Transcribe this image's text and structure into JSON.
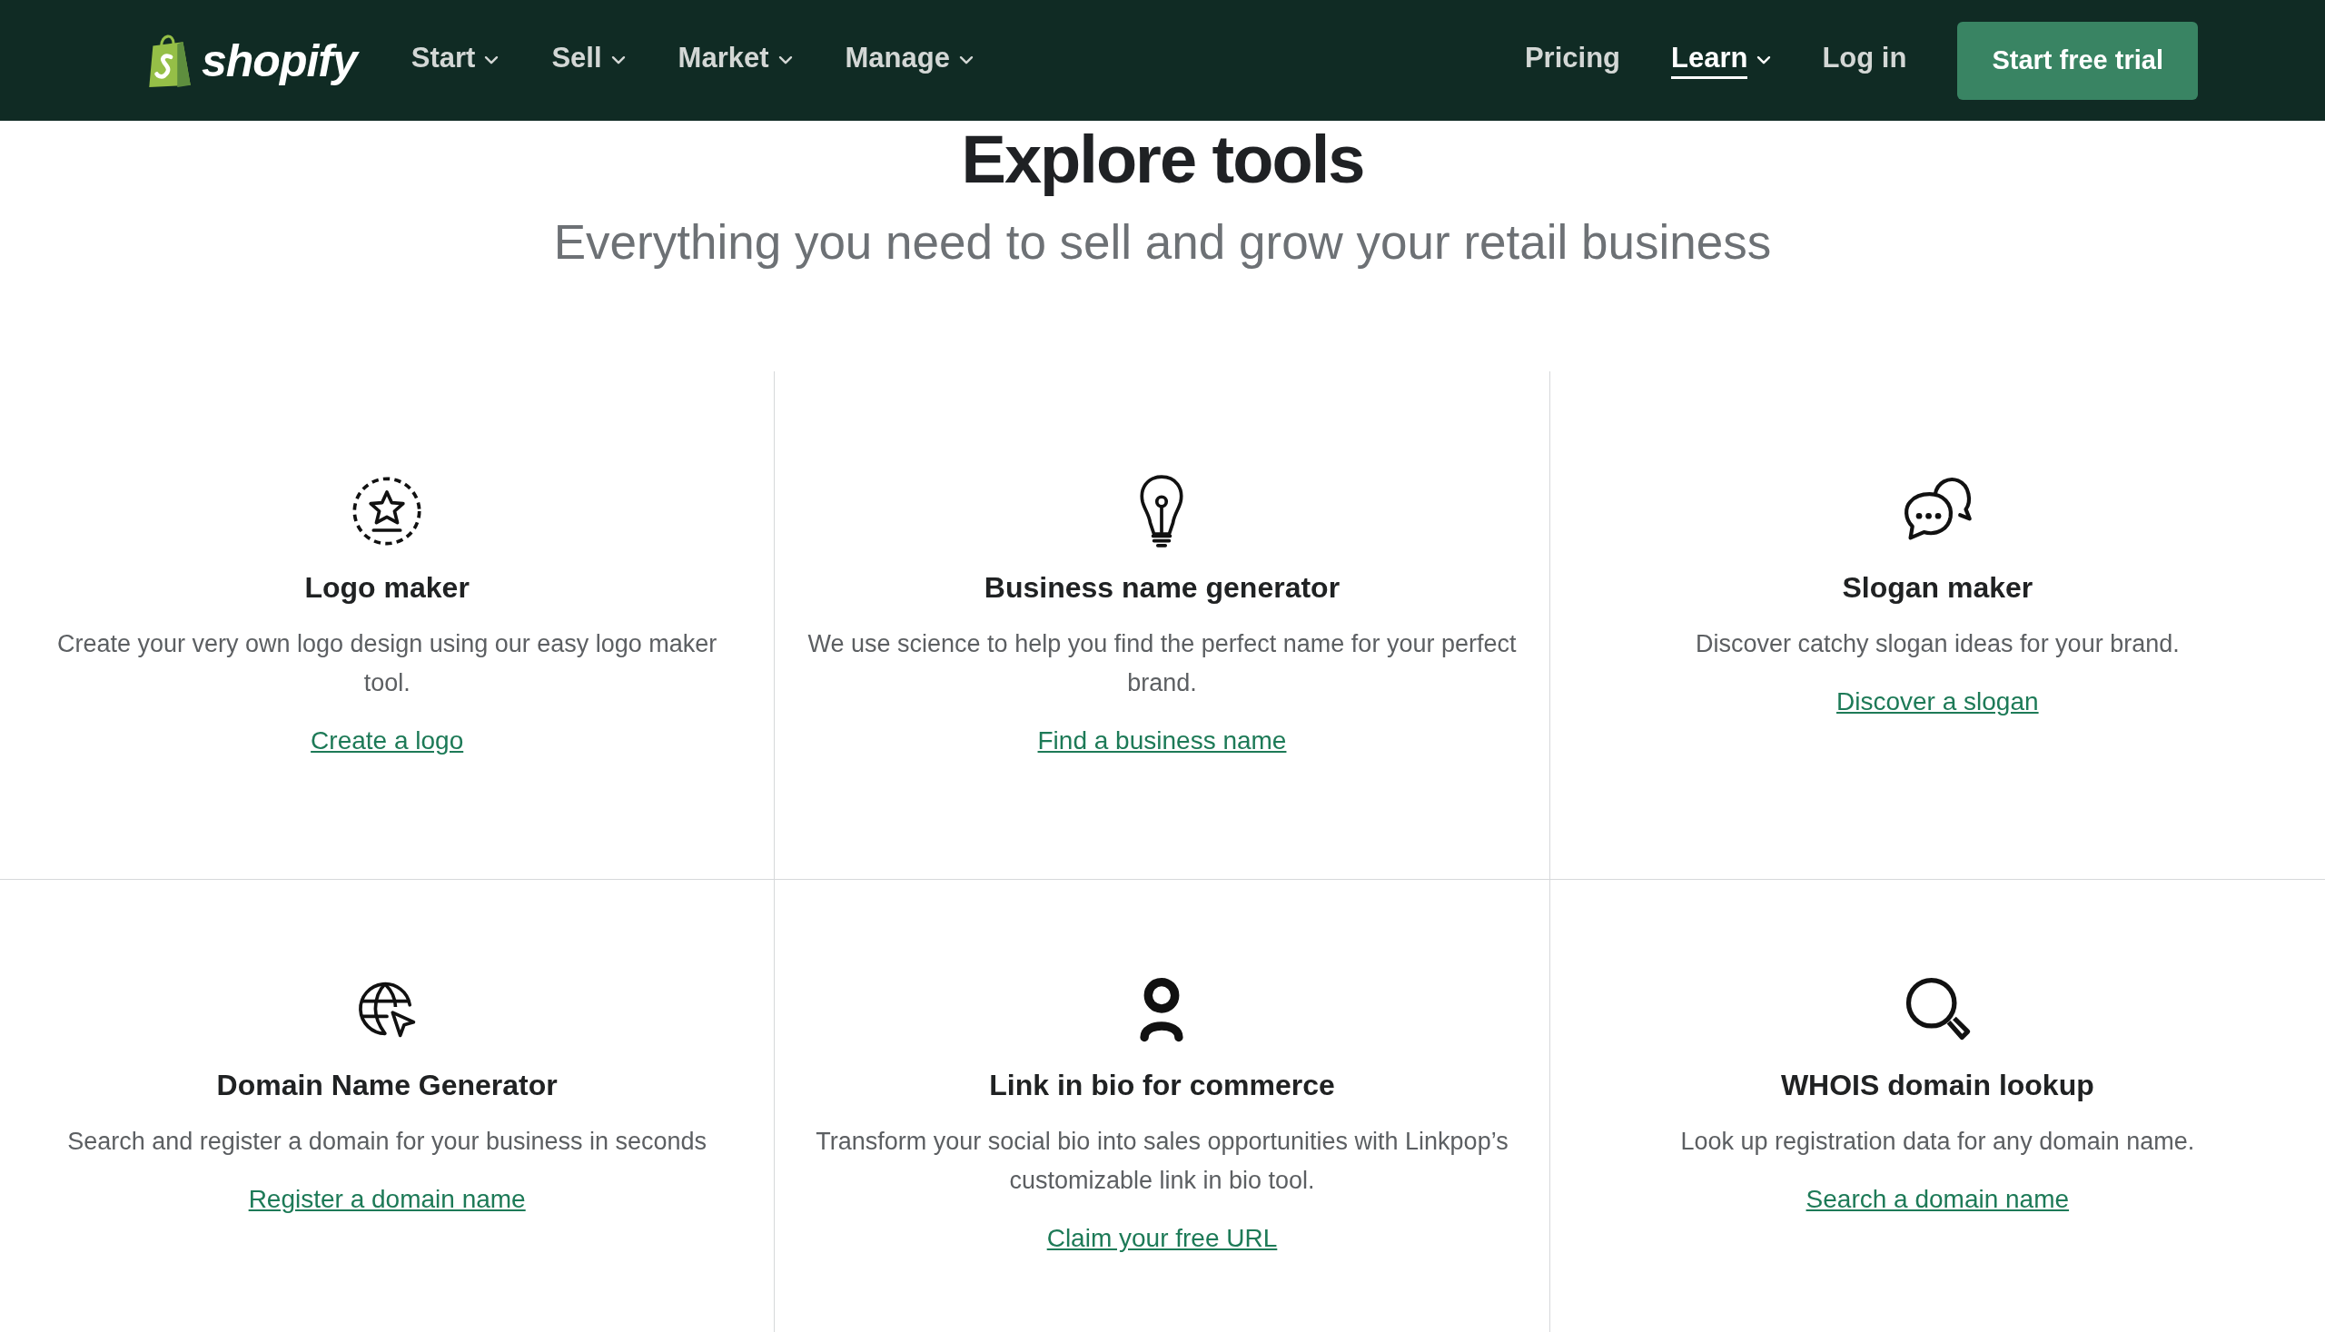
{
  "nav": {
    "logo": "shopify",
    "menu": [
      {
        "label": "Start",
        "selected": false
      },
      {
        "label": "Sell",
        "selected": false
      },
      {
        "label": "Market",
        "selected": false
      },
      {
        "label": "Manage",
        "selected": false
      }
    ],
    "right": [
      {
        "label": "Pricing",
        "kind": "link",
        "selected": false
      },
      {
        "label": "Learn",
        "kind": "dropdown",
        "selected": true
      },
      {
        "label": "Log in",
        "kind": "link",
        "selected": false
      }
    ],
    "cta": "Start free trial"
  },
  "heading": "Explore tools",
  "subheading": "Everything you need to sell and grow your retail business",
  "tools": [
    {
      "title": "Logo maker",
      "description": "Create your very own logo design using our easy logo maker tool.",
      "link": "Create a logo"
    },
    {
      "title": "Business name generator",
      "description": "We use science to help you find the perfect name for your perfect brand.",
      "link": "Find a business name"
    },
    {
      "title": "Slogan maker",
      "description": "Discover catchy slogan ideas for your brand.",
      "link": "Discover a slogan"
    },
    {
      "title": "Domain Name Generator",
      "description": "Search and register a domain for your business in seconds",
      "link": "Register a domain name"
    },
    {
      "title": "Link in bio for commerce",
      "description": "Transform your social bio into sales opportunities with Linkpop’s customizable link in bio tool.",
      "link": "Claim your free URL"
    },
    {
      "title": "WHOIS domain lookup",
      "description": "Look up registration data for any domain name.",
      "link": "Search a domain name"
    }
  ]
}
